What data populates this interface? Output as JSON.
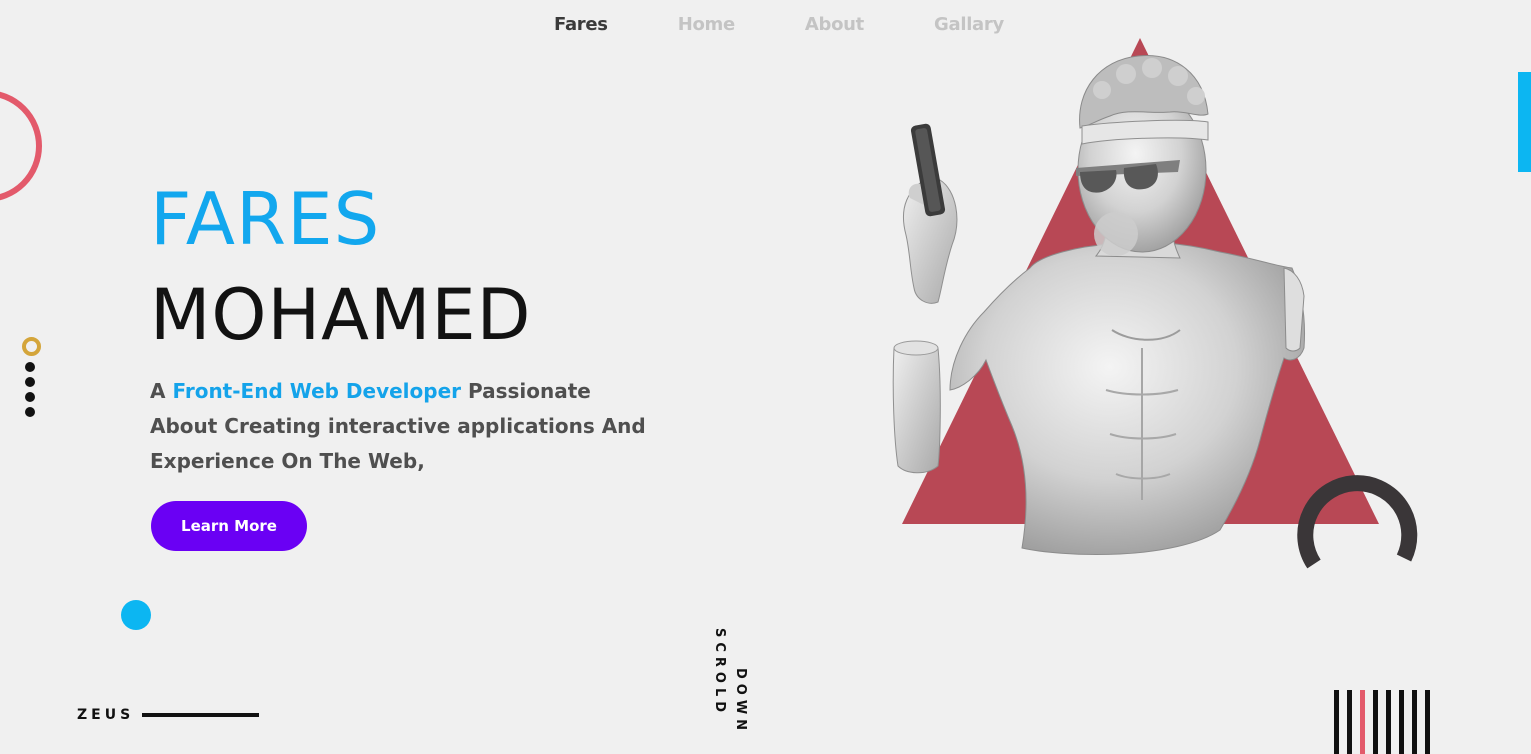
{
  "nav": {
    "brand": "Fares",
    "items": [
      "Home",
      "About",
      "Gallary"
    ]
  },
  "hero": {
    "first_name": "FARES",
    "last_name": "MOHAMED",
    "desc_prefix": "A ",
    "desc_accent": "Front-End Web Developer",
    "desc_suffix": " Passionate About Creating interactive applications And Experience On The Web,",
    "cta_label": "Learn More"
  },
  "footer": {
    "brand_label": "ZEUS"
  },
  "scroll": {
    "word1": "SCROLD",
    "word2": "DOWN"
  },
  "colors": {
    "accent_blue": "#12a7ee",
    "button_purple": "#6a00f4",
    "triangle_red": "#b84855",
    "ring_red": "#e35a6b",
    "background": "#f0f0f0"
  },
  "icons": [
    "statue-image",
    "red-triangle-shape",
    "dark-arc-shape",
    "blue-side-bar",
    "striped-lines"
  ]
}
